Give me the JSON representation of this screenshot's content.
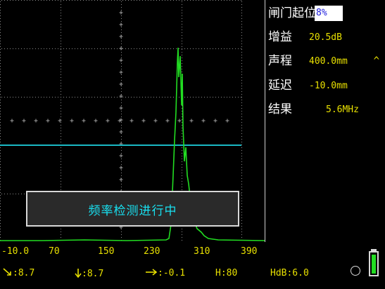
{
  "params": {
    "gate_start": {
      "label": "闸门起位",
      "value": "8%"
    },
    "gain": {
      "label": "增益",
      "value": "20.5dB"
    },
    "range": {
      "label": "声程",
      "value": "400.0mm",
      "caret": "^"
    },
    "delay": {
      "label": "延迟",
      "value": "-10.0mm"
    },
    "result": {
      "label": "结果",
      "value": "5.6MHz"
    }
  },
  "message": "频率检测进行中",
  "axis": {
    "ticks": [
      "-10.0",
      "70",
      "150",
      "230",
      "310",
      "390"
    ]
  },
  "status": {
    "s1": ":8.7",
    "s2": ":8.7",
    "s3": ":-0.1",
    "s4": "H:80",
    "s5": "HdB:6.0"
  },
  "battery_level": 0.85,
  "colors": {
    "trace": "#22dd22",
    "gate": "#1ab8c4",
    "grid": "#8a8a8a",
    "value": "#e8e000"
  },
  "icons": {
    "s1": "probe-angle-icon",
    "s2": "depth-down-icon",
    "s3": "horizontal-distance-icon"
  }
}
